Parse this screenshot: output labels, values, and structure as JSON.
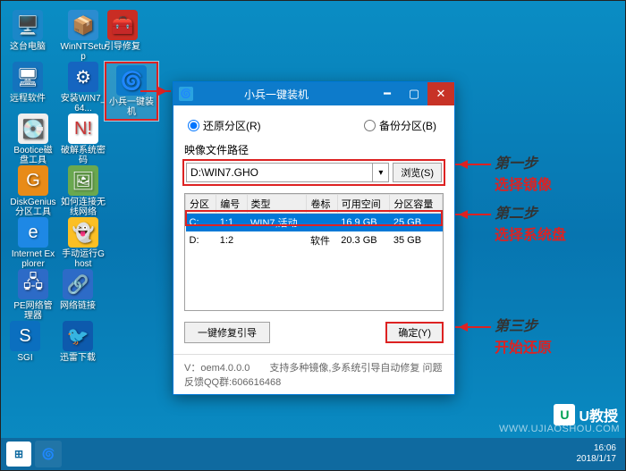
{
  "desktop_icons": {
    "c0r0": "这台电脑",
    "c1r0": "WinNTSetup",
    "c2r0": "引导修复",
    "c0r1": "远程软件",
    "c1r1": "安装WIN7_64...",
    "c2r1": "小兵一键装机",
    "c0r2": "Bootice磁盘工具",
    "c1r2": "破解系统密码",
    "c0r3": "DiskGenius分区工具",
    "c1r3": "如何连接无线网络",
    "c0r4": "Internet Explorer",
    "c1r4": "手动运行Ghost",
    "c0r5": "PE网络管理器",
    "c1r5": "网络链接",
    "c0r6": "SGI",
    "c1r6": "迅雷下载"
  },
  "dialog": {
    "title": "小兵一键装机",
    "radio_restore": "还原分区(R)",
    "radio_backup": "备份分区(B)",
    "path_label": "映像文件路径",
    "path_value": "D:\\WIN7.GHO",
    "browse_btn": "浏览(S)",
    "columns": {
      "c0": "分区",
      "c1": "编号",
      "c2": "类型",
      "c3": "卷标",
      "c4": "可用空间",
      "c5": "分区容量"
    },
    "rows": [
      {
        "part": "C:",
        "num": "1:1",
        "type": "WIN7,活动",
        "label": "",
        "free": "16.9 GB",
        "size": "25 GB"
      },
      {
        "part": "D:",
        "num": "1:2",
        "type": "",
        "label": "软件",
        "free": "20.3 GB",
        "size": "35 GB"
      }
    ],
    "repair_btn": "一键修复引导",
    "ok_btn": "确定(Y)",
    "footer": "V：oem4.0.0.0　　支持多种镜像,多系统引导自动修复  问题反馈QQ群:606616468"
  },
  "annotations": {
    "step1a": "第一步",
    "step1b": "选择镜像",
    "step2a": "第二步",
    "step2b": "选择系统盘",
    "step3a": "第三步",
    "step3b": "开始还原"
  },
  "taskbar": {
    "time": "16:06",
    "date": "2018/1/17"
  },
  "watermark": "WWW.UJIAOSHOU.COM",
  "logo": "U教授"
}
